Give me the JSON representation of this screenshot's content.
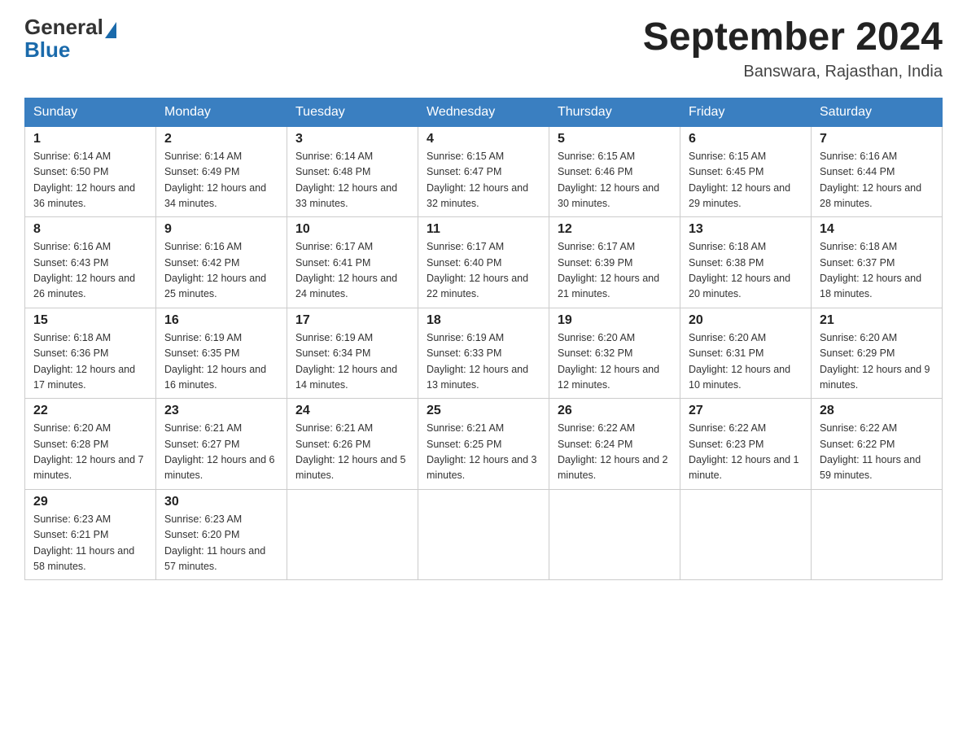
{
  "header": {
    "logo_general": "General",
    "logo_blue": "Blue",
    "month_year": "September 2024",
    "location": "Banswara, Rajasthan, India"
  },
  "days_of_week": [
    "Sunday",
    "Monday",
    "Tuesday",
    "Wednesday",
    "Thursday",
    "Friday",
    "Saturday"
  ],
  "weeks": [
    [
      {
        "day": "1",
        "sunrise": "6:14 AM",
        "sunset": "6:50 PM",
        "daylight": "12 hours and 36 minutes."
      },
      {
        "day": "2",
        "sunrise": "6:14 AM",
        "sunset": "6:49 PM",
        "daylight": "12 hours and 34 minutes."
      },
      {
        "day": "3",
        "sunrise": "6:14 AM",
        "sunset": "6:48 PM",
        "daylight": "12 hours and 33 minutes."
      },
      {
        "day": "4",
        "sunrise": "6:15 AM",
        "sunset": "6:47 PM",
        "daylight": "12 hours and 32 minutes."
      },
      {
        "day": "5",
        "sunrise": "6:15 AM",
        "sunset": "6:46 PM",
        "daylight": "12 hours and 30 minutes."
      },
      {
        "day": "6",
        "sunrise": "6:15 AM",
        "sunset": "6:45 PM",
        "daylight": "12 hours and 29 minutes."
      },
      {
        "day": "7",
        "sunrise": "6:16 AM",
        "sunset": "6:44 PM",
        "daylight": "12 hours and 28 minutes."
      }
    ],
    [
      {
        "day": "8",
        "sunrise": "6:16 AM",
        "sunset": "6:43 PM",
        "daylight": "12 hours and 26 minutes."
      },
      {
        "day": "9",
        "sunrise": "6:16 AM",
        "sunset": "6:42 PM",
        "daylight": "12 hours and 25 minutes."
      },
      {
        "day": "10",
        "sunrise": "6:17 AM",
        "sunset": "6:41 PM",
        "daylight": "12 hours and 24 minutes."
      },
      {
        "day": "11",
        "sunrise": "6:17 AM",
        "sunset": "6:40 PM",
        "daylight": "12 hours and 22 minutes."
      },
      {
        "day": "12",
        "sunrise": "6:17 AM",
        "sunset": "6:39 PM",
        "daylight": "12 hours and 21 minutes."
      },
      {
        "day": "13",
        "sunrise": "6:18 AM",
        "sunset": "6:38 PM",
        "daylight": "12 hours and 20 minutes."
      },
      {
        "day": "14",
        "sunrise": "6:18 AM",
        "sunset": "6:37 PM",
        "daylight": "12 hours and 18 minutes."
      }
    ],
    [
      {
        "day": "15",
        "sunrise": "6:18 AM",
        "sunset": "6:36 PM",
        "daylight": "12 hours and 17 minutes."
      },
      {
        "day": "16",
        "sunrise": "6:19 AM",
        "sunset": "6:35 PM",
        "daylight": "12 hours and 16 minutes."
      },
      {
        "day": "17",
        "sunrise": "6:19 AM",
        "sunset": "6:34 PM",
        "daylight": "12 hours and 14 minutes."
      },
      {
        "day": "18",
        "sunrise": "6:19 AM",
        "sunset": "6:33 PM",
        "daylight": "12 hours and 13 minutes."
      },
      {
        "day": "19",
        "sunrise": "6:20 AM",
        "sunset": "6:32 PM",
        "daylight": "12 hours and 12 minutes."
      },
      {
        "day": "20",
        "sunrise": "6:20 AM",
        "sunset": "6:31 PM",
        "daylight": "12 hours and 10 minutes."
      },
      {
        "day": "21",
        "sunrise": "6:20 AM",
        "sunset": "6:29 PM",
        "daylight": "12 hours and 9 minutes."
      }
    ],
    [
      {
        "day": "22",
        "sunrise": "6:20 AM",
        "sunset": "6:28 PM",
        "daylight": "12 hours and 7 minutes."
      },
      {
        "day": "23",
        "sunrise": "6:21 AM",
        "sunset": "6:27 PM",
        "daylight": "12 hours and 6 minutes."
      },
      {
        "day": "24",
        "sunrise": "6:21 AM",
        "sunset": "6:26 PM",
        "daylight": "12 hours and 5 minutes."
      },
      {
        "day": "25",
        "sunrise": "6:21 AM",
        "sunset": "6:25 PM",
        "daylight": "12 hours and 3 minutes."
      },
      {
        "day": "26",
        "sunrise": "6:22 AM",
        "sunset": "6:24 PM",
        "daylight": "12 hours and 2 minutes."
      },
      {
        "day": "27",
        "sunrise": "6:22 AM",
        "sunset": "6:23 PM",
        "daylight": "12 hours and 1 minute."
      },
      {
        "day": "28",
        "sunrise": "6:22 AM",
        "sunset": "6:22 PM",
        "daylight": "11 hours and 59 minutes."
      }
    ],
    [
      {
        "day": "29",
        "sunrise": "6:23 AM",
        "sunset": "6:21 PM",
        "daylight": "11 hours and 58 minutes."
      },
      {
        "day": "30",
        "sunrise": "6:23 AM",
        "sunset": "6:20 PM",
        "daylight": "11 hours and 57 minutes."
      },
      null,
      null,
      null,
      null,
      null
    ]
  ]
}
